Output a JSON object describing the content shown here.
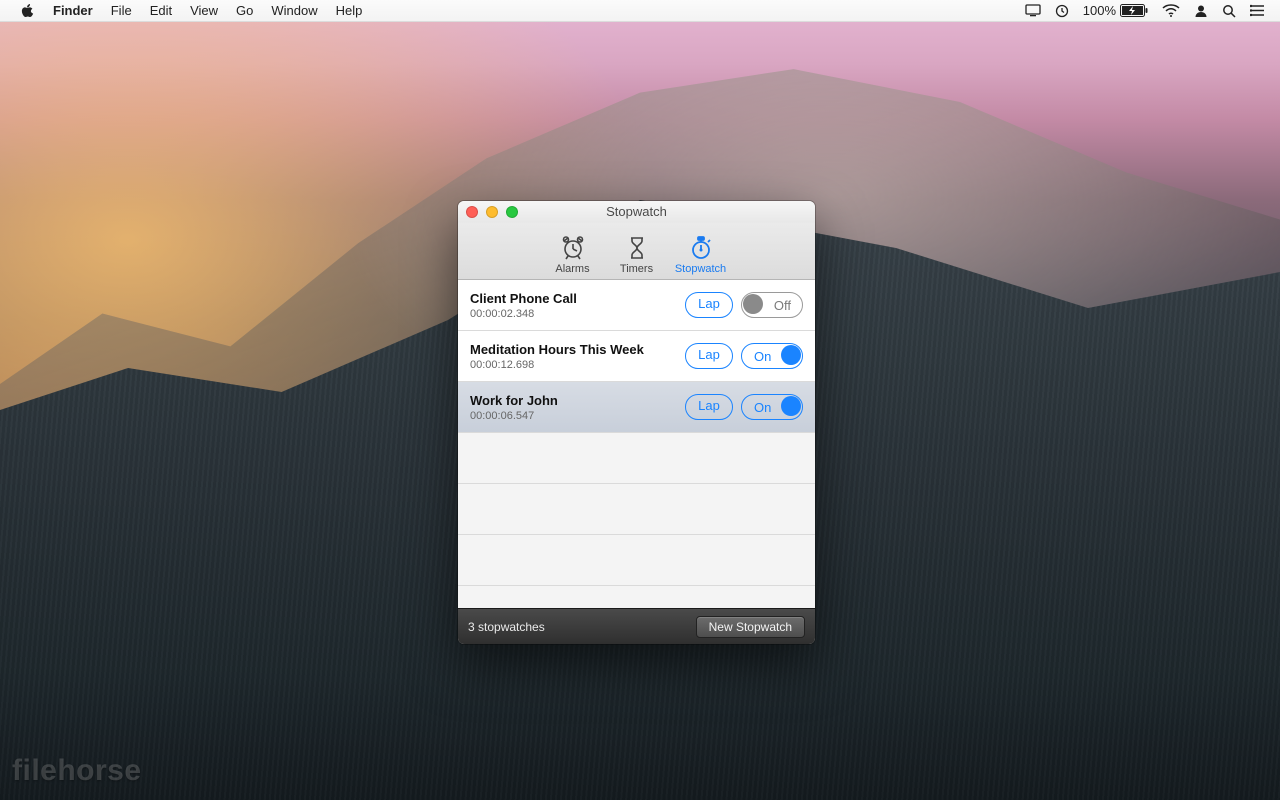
{
  "menubar": {
    "left": [
      "Finder",
      "File",
      "Edit",
      "View",
      "Go",
      "Window",
      "Help"
    ],
    "battery_pct": "100%"
  },
  "window": {
    "title": "Stopwatch",
    "tabs": [
      {
        "id": "alarms",
        "label": "Alarms",
        "active": false
      },
      {
        "id": "timers",
        "label": "Timers",
        "active": false
      },
      {
        "id": "stopwatch",
        "label": "Stopwatch",
        "active": true
      }
    ],
    "lap_label": "Lap",
    "on_label": "On",
    "off_label": "Off",
    "rows": [
      {
        "name": "Client Phone Call",
        "time": "00:00:02.348",
        "running": false,
        "selected": false
      },
      {
        "name": "Meditation Hours This Week",
        "time": "00:00:12.698",
        "running": true,
        "selected": false
      },
      {
        "name": "Work for John",
        "time": "00:00:06.547",
        "running": true,
        "selected": true
      }
    ],
    "footer_count": "3 stopwatches",
    "new_button": "New Stopwatch"
  },
  "watermark": "filehorse"
}
